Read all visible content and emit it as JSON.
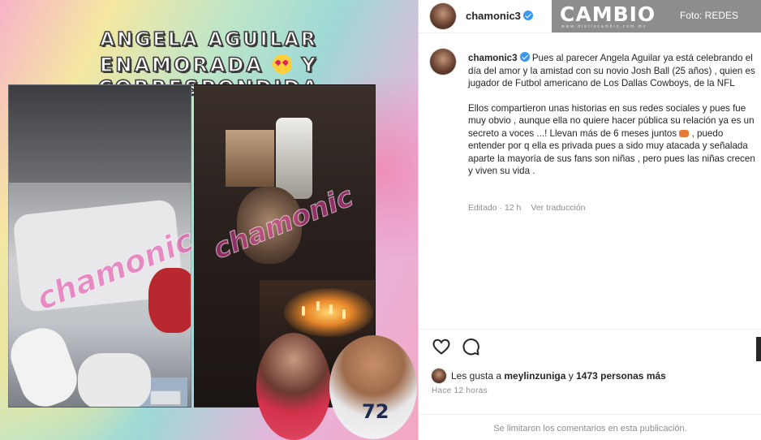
{
  "post_image": {
    "headline_line1": "ANGELA AGUILAR",
    "headline_line2a": "ENAMORADA",
    "headline_line2b": "Y CORRESPONDIDA",
    "watermark": "chamonic"
  },
  "post_header": {
    "username": "chamonic3"
  },
  "caption": {
    "username": "chamonic3",
    "paragraph1": "Pues al parecer Angela Aguilar ya está celebrando el día del amor y la amistad con su novio Josh Ball (25 años) , quien es jugador de Futbol americano de Los Dallas Cowboys, de la NFL",
    "paragraph2a": "Ellos compartieron unas historias en sus redes sociales y pues fue muy obvio , aunque ella no quiere hacer pública su relación ya es un secreto a voces ...! Llevan más de 6 meses juntos",
    "paragraph2b": ", puedo entender por q ella es privada pues a sido muy atacada y señalada aparte la mayoría de sus fans son niñas , pero pues las niñas crecen y viven su vida .",
    "edited": "Editado · 12 h",
    "see_translation": "Ver traducción"
  },
  "likes": {
    "prefix": "Les gusta a",
    "user": "meylinzuniga",
    "middle": "y",
    "others": "1473 personas más"
  },
  "post_time": "Hace 12 horas",
  "comments_disabled": "Se limitaron los comentarios en esta publicación.",
  "cambio": {
    "logo": "CAMBIO",
    "sub": "w w w . d i a r i o c a m b i o . c o m . m x",
    "photo_credit": "Foto: REDES"
  },
  "icons": [
    "verified-badge-icon",
    "heart-icon",
    "comment-icon"
  ],
  "colors": {
    "verified": "#3897f0",
    "text": "#262626",
    "muted": "#8e8e8e",
    "watermark": "#e23ca0"
  }
}
